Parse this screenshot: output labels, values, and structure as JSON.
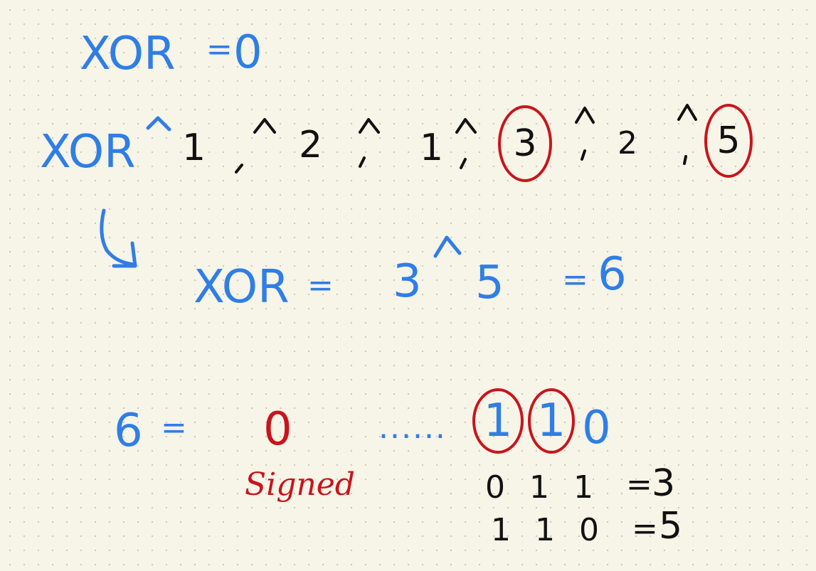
{
  "line1": {
    "lhs": "XOR",
    "eq": "=",
    "rhs": "0"
  },
  "line2": {
    "start": "XOR",
    "tokens": [
      "1",
      "2",
      "1",
      "3",
      "2",
      "5"
    ]
  },
  "line3": {
    "lhs": "XOR",
    "eq1": "=",
    "a": "3",
    "b": "5",
    "eq2": "=",
    "result": "6"
  },
  "line4": {
    "lhs": "6",
    "eq": "=",
    "sign_bit": "0",
    "dots": "......",
    "bits": [
      "1",
      "1",
      "0"
    ],
    "note": "Signed"
  },
  "binary_rows": [
    {
      "bits": "0 1 1",
      "eq": "=",
      "value": "3"
    },
    {
      "bits": "1 1 0",
      "eq": "=",
      "value": "5"
    }
  ],
  "colors": {
    "blue": "#2f7ee6",
    "red": "#c9141b",
    "black": "#111111",
    "paper": "#f7f4e8"
  }
}
